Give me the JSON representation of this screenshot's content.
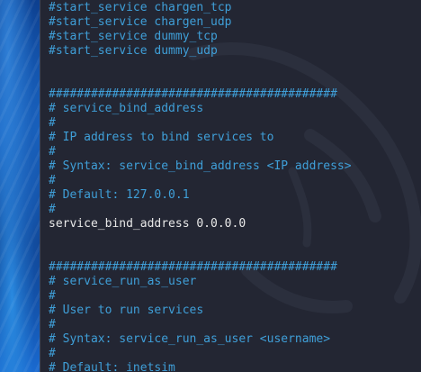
{
  "theme": {
    "background": "#232633",
    "comment_color": "#3f9fd8",
    "code_color": "#e8e8e8",
    "desktop_color": "#1560c0"
  },
  "editor": {
    "lines": [
      {
        "type": "comment",
        "text": "#start_service chargen_tcp"
      },
      {
        "type": "comment",
        "text": "#start_service chargen_udp"
      },
      {
        "type": "comment",
        "text": "#start_service dummy_tcp"
      },
      {
        "type": "comment",
        "text": "#start_service dummy_udp"
      },
      {
        "type": "empty",
        "text": ""
      },
      {
        "type": "empty",
        "text": ""
      },
      {
        "type": "comment",
        "text": "#########################################"
      },
      {
        "type": "comment",
        "text": "# service_bind_address"
      },
      {
        "type": "comment",
        "text": "#"
      },
      {
        "type": "comment",
        "text": "# IP address to bind services to"
      },
      {
        "type": "comment",
        "text": "#"
      },
      {
        "type": "comment",
        "text": "# Syntax: service_bind_address <IP address>"
      },
      {
        "type": "comment",
        "text": "#"
      },
      {
        "type": "comment",
        "text": "# Default: 127.0.0.1"
      },
      {
        "type": "comment",
        "text": "#"
      },
      {
        "type": "code",
        "text": "service_bind_address 0.0.0.0"
      },
      {
        "type": "empty",
        "text": ""
      },
      {
        "type": "empty",
        "text": ""
      },
      {
        "type": "comment",
        "text": "#########################################"
      },
      {
        "type": "comment",
        "text": "# service_run_as_user"
      },
      {
        "type": "comment",
        "text": "#"
      },
      {
        "type": "comment",
        "text": "# User to run services"
      },
      {
        "type": "comment",
        "text": "#"
      },
      {
        "type": "comment",
        "text": "# Syntax: service_run_as_user <username>"
      },
      {
        "type": "comment",
        "text": "#"
      },
      {
        "type": "comment",
        "text": "# Default: inetsim"
      }
    ]
  }
}
